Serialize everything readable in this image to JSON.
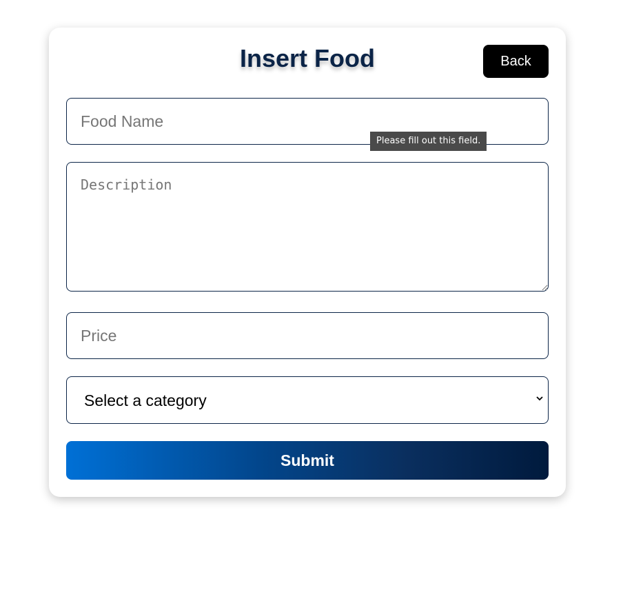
{
  "form": {
    "title": "Insert Food",
    "back_label": "Back",
    "food_name_placeholder": "Food Name",
    "description_placeholder": "Description",
    "price_placeholder": "Price",
    "category_selected": "Select a category",
    "submit_label": "Submit"
  },
  "validation": {
    "tooltip": "Please fill out this field."
  },
  "colors": {
    "title": "#0b2447",
    "border": "#0b2447",
    "back_button": "#000000",
    "submit_gradient_start": "#0070d6",
    "submit_gradient_end": "#001a3d"
  }
}
